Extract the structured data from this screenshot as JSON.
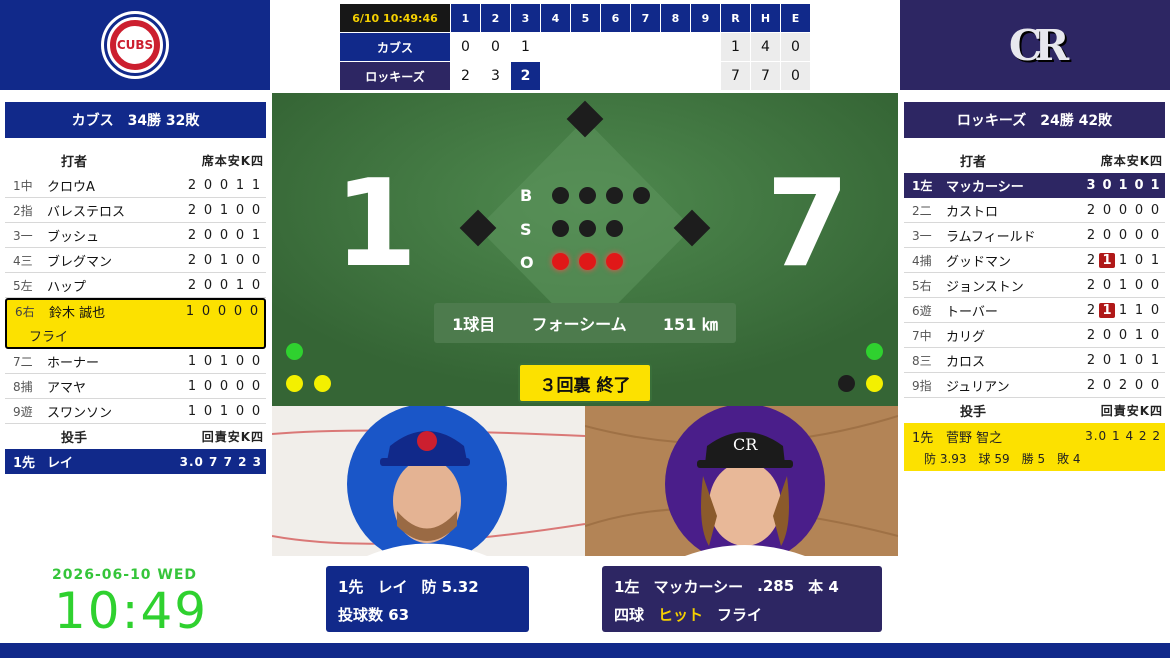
{
  "banners": {
    "cubs_logo_text": "CUBS",
    "rockies_logo_text": "CR"
  },
  "linescore": {
    "time": "6/10 10:49:46",
    "innings": [
      "1",
      "2",
      "3",
      "4",
      "5",
      "6",
      "7",
      "8",
      "9"
    ],
    "totals_headers": [
      "R",
      "H",
      "E"
    ],
    "teams": [
      {
        "name": "カブス",
        "innings": [
          "0",
          "0",
          "1",
          "",
          "",
          "",
          "",
          "",
          ""
        ],
        "totals": [
          "1",
          "4",
          "0"
        ]
      },
      {
        "name": "ロッキーズ",
        "innings": [
          "2",
          "3",
          "2",
          "",
          "",
          "",
          "",
          "",
          ""
        ],
        "totals": [
          "7",
          "7",
          "0"
        ]
      }
    ]
  },
  "cubs": {
    "header": "カブス　34勝 32敗",
    "batting_label": "打者",
    "batting_cols": "席本安K四",
    "batters": [
      {
        "pos": "1中",
        "name": "クロウA",
        "stats": [
          "2",
          "0",
          "0",
          "1",
          "1"
        ]
      },
      {
        "pos": "2指",
        "name": "バレステロス",
        "stats": [
          "2",
          "0",
          "1",
          "0",
          "0"
        ]
      },
      {
        "pos": "3一",
        "name": "ブッシュ",
        "stats": [
          "2",
          "0",
          "0",
          "0",
          "1"
        ]
      },
      {
        "pos": "4三",
        "name": "ブレグマン",
        "stats": [
          "2",
          "0",
          "1",
          "0",
          "0"
        ]
      },
      {
        "pos": "5左",
        "name": "ハップ",
        "stats": [
          "2",
          "0",
          "0",
          "1",
          "0"
        ]
      },
      {
        "pos": "6右",
        "name": "鈴木 誠也",
        "stats": [
          "1",
          "0",
          "0",
          "0",
          "0"
        ],
        "result": "フライ"
      },
      {
        "pos": "7二",
        "name": "ホーナー",
        "stats": [
          "1",
          "0",
          "1",
          "0",
          "0"
        ]
      },
      {
        "pos": "8捕",
        "name": "アマヤ",
        "stats": [
          "1",
          "0",
          "0",
          "0",
          "0"
        ]
      },
      {
        "pos": "9遊",
        "name": "スワンソン",
        "stats": [
          "1",
          "0",
          "1",
          "0",
          "0"
        ]
      }
    ],
    "pitching_label": "投手",
    "pitching_cols": "回責安K四",
    "pitcher": {
      "pos": "1先",
      "name": "レイ",
      "stats": "3.0 7 7 2 3"
    }
  },
  "rockies": {
    "header": "ロッキーズ　24勝 42敗",
    "batting_label": "打者",
    "batting_cols": "席本安K四",
    "batters": [
      {
        "pos": "1左",
        "name": "マッカーシー",
        "stats": [
          "3",
          "0",
          "1",
          "0",
          "1"
        ]
      },
      {
        "pos": "2二",
        "name": "カストロ",
        "stats": [
          "2",
          "0",
          "0",
          "0",
          "0"
        ]
      },
      {
        "pos": "3一",
        "name": "ラムフィールド",
        "stats": [
          "2",
          "0",
          "0",
          "0",
          "0"
        ]
      },
      {
        "pos": "4捕",
        "name": "グッドマン",
        "stats": [
          "2",
          "1",
          "1",
          "0",
          "1"
        ]
      },
      {
        "pos": "5右",
        "name": "ジョンストン",
        "stats": [
          "2",
          "0",
          "1",
          "0",
          "0"
        ]
      },
      {
        "pos": "6遊",
        "name": "トーバー",
        "stats": [
          "2",
          "1",
          "1",
          "1",
          "0"
        ]
      },
      {
        "pos": "7中",
        "name": "カリグ",
        "stats": [
          "2",
          "0",
          "0",
          "1",
          "0"
        ]
      },
      {
        "pos": "8三",
        "name": "カロス",
        "stats": [
          "2",
          "0",
          "1",
          "0",
          "1"
        ]
      },
      {
        "pos": "9指",
        "name": "ジュリアン",
        "stats": [
          "2",
          "0",
          "2",
          "0",
          "0"
        ]
      }
    ],
    "pitching_label": "投手",
    "pitching_cols": "回責安K四",
    "pitcher": {
      "pos": "1先",
      "name": "菅野 智之",
      "stats": "3.0 1 4 2 2",
      "era": "防 3.93",
      "pitches": "球 59",
      "wins": "勝 5",
      "losses": "敗 4"
    }
  },
  "scoreboard": {
    "away_score": "1",
    "home_score": "7",
    "bso_labels": [
      "B",
      "S",
      "O"
    ],
    "balls": 0,
    "strikes": 0,
    "outs": 3,
    "pitch_count_label": "1球目",
    "pitch_type": "フォーシーム",
    "pitch_speed": "151 ㎞",
    "inning_status": "３回裏 終了"
  },
  "pitcher_info": {
    "pos": "1先",
    "name": "レイ",
    "era": "防 5.32",
    "pitches": "投球数 63"
  },
  "batter_info": {
    "pos": "1左",
    "name": "マッカーシー",
    "avg": ".285",
    "hr": "本 4",
    "results": [
      "四球",
      "ヒット",
      "フライ"
    ]
  },
  "clock": {
    "date": "2026-06-10 WED",
    "time": "10:49"
  },
  "colors": {
    "cubs_blue": "#11298a",
    "rockies_purple": "#2d2663",
    "highlight": "#fce100",
    "field": "#3a6f3a"
  }
}
